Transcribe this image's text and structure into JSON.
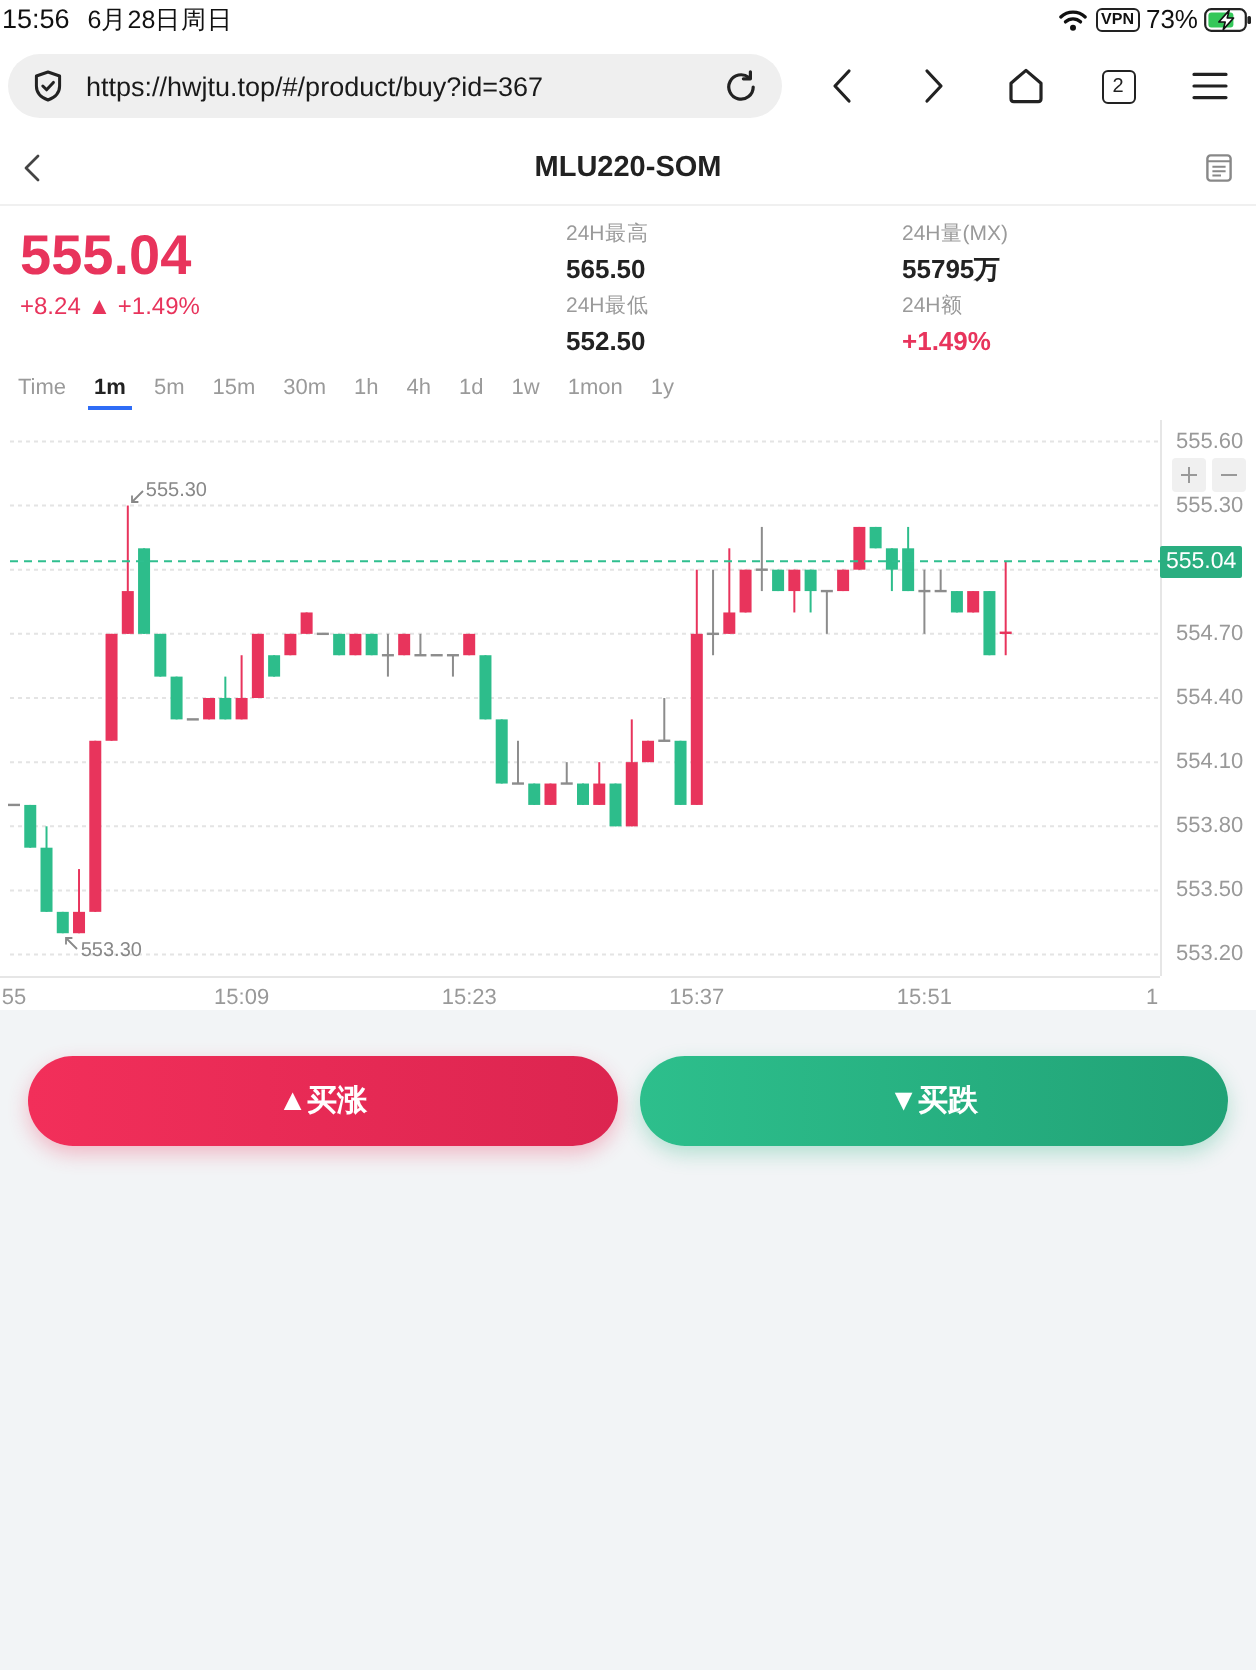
{
  "status_bar": {
    "time": "15:56",
    "date": "6月28日周日",
    "vpn": "VPN",
    "battery": "73%",
    "charging": true
  },
  "browser": {
    "url": "https://hwjtu.top/#/product/buy?id=367",
    "tab_count": "2"
  },
  "header": {
    "title": "MLU220-SOM"
  },
  "quote": {
    "price": "555.04",
    "change": "+8.24 ▲ +1.49%",
    "kind": "up",
    "stats": [
      {
        "label": "24H最高",
        "value": "565.50",
        "kind": "plain"
      },
      {
        "label": "24H量(MX)",
        "value": "55795万",
        "kind": "plain"
      },
      {
        "label": "24H最低",
        "value": "552.50",
        "kind": "plain"
      },
      {
        "label": "24H额",
        "value": "+1.49%",
        "kind": "up"
      }
    ]
  },
  "intervals": [
    {
      "label": "Time",
      "selected": false
    },
    {
      "label": "1m",
      "selected": true
    },
    {
      "label": "5m",
      "selected": false
    },
    {
      "label": "15m",
      "selected": false
    },
    {
      "label": "30m",
      "selected": false
    },
    {
      "label": "1h",
      "selected": false
    },
    {
      "label": "4h",
      "selected": false
    },
    {
      "label": "1d",
      "selected": false
    },
    {
      "label": "1w",
      "selected": false
    },
    {
      "label": "1mon",
      "selected": false
    },
    {
      "label": "1y",
      "selected": false
    }
  ],
  "chart": {
    "chart_data": {
      "type": "candlestick",
      "categories": [
        "55",
        null,
        null,
        null,
        null,
        null,
        null,
        null,
        null,
        null,
        null,
        null,
        null,
        null,
        "15:09",
        null,
        null,
        null,
        null,
        null,
        null,
        null,
        null,
        null,
        null,
        null,
        null,
        null,
        "15:23",
        null,
        null,
        null,
        null,
        null,
        null,
        null,
        null,
        null,
        null,
        null,
        null,
        null,
        "15:37",
        null,
        null,
        null,
        null,
        null,
        null,
        null,
        null,
        null,
        null,
        null,
        null,
        null,
        "15:51",
        null,
        null,
        null,
        null,
        null,
        null,
        null,
        null,
        null,
        null,
        null,
        null,
        null,
        "1"
      ],
      "ohlc": [
        [
          553.9,
          553.9,
          553.9,
          553.9
        ],
        [
          553.9,
          553.9,
          553.7,
          553.7
        ],
        [
          553.7,
          553.8,
          553.4,
          553.4
        ],
        [
          553.4,
          553.4,
          553.3,
          553.3
        ],
        [
          553.3,
          553.6,
          553.3,
          553.4
        ],
        [
          553.4,
          554.2,
          553.4,
          554.2
        ],
        [
          554.2,
          554.7,
          554.2,
          554.7
        ],
        [
          554.7,
          555.3,
          554.7,
          554.9
        ],
        [
          555.1,
          555.1,
          554.7,
          554.7
        ],
        [
          554.7,
          554.7,
          554.5,
          554.5
        ],
        [
          554.5,
          554.5,
          554.3,
          554.3
        ],
        [
          554.3,
          554.3,
          554.3,
          554.3
        ],
        [
          554.3,
          554.4,
          554.3,
          554.4
        ],
        [
          554.4,
          554.5,
          554.3,
          554.3
        ],
        [
          554.3,
          554.6,
          554.3,
          554.4
        ],
        [
          554.4,
          554.7,
          554.4,
          554.7
        ],
        [
          554.6,
          554.6,
          554.5,
          554.5
        ],
        [
          554.6,
          554.7,
          554.6,
          554.7
        ],
        [
          554.7,
          554.8,
          554.7,
          554.8
        ],
        [
          554.7,
          554.7,
          554.7,
          554.7
        ],
        [
          554.7,
          554.7,
          554.6,
          554.6
        ],
        [
          554.6,
          554.7,
          554.6,
          554.7
        ],
        [
          554.7,
          554.7,
          554.6,
          554.6
        ],
        [
          554.6,
          554.7,
          554.5,
          554.6
        ],
        [
          554.6,
          554.7,
          554.6,
          554.7
        ],
        [
          554.6,
          554.7,
          554.6,
          554.6
        ],
        [
          554.6,
          554.6,
          554.6,
          554.6
        ],
        [
          554.6,
          554.6,
          554.5,
          554.6
        ],
        [
          554.6,
          554.7,
          554.6,
          554.7
        ],
        [
          554.6,
          554.6,
          554.3,
          554.3
        ],
        [
          554.3,
          554.3,
          554.0,
          554.0
        ],
        [
          554.0,
          554.2,
          554.0,
          554.0
        ],
        [
          554.0,
          554.0,
          553.9,
          553.9
        ],
        [
          553.9,
          554.0,
          553.9,
          554.0
        ],
        [
          554.0,
          554.1,
          554.0,
          554.0
        ],
        [
          554.0,
          554.0,
          553.9,
          553.9
        ],
        [
          553.9,
          554.1,
          553.9,
          554.0
        ],
        [
          554.0,
          554.0,
          553.8,
          553.8
        ],
        [
          553.8,
          554.3,
          553.8,
          554.1
        ],
        [
          554.1,
          554.2,
          554.1,
          554.2
        ],
        [
          554.2,
          554.4,
          554.2,
          554.2
        ],
        [
          554.2,
          554.2,
          553.9,
          553.9
        ],
        [
          553.9,
          555.0,
          553.9,
          554.7
        ],
        [
          554.7,
          555.0,
          554.6,
          554.7
        ],
        [
          554.7,
          555.1,
          554.7,
          554.8
        ],
        [
          554.8,
          555.0,
          554.8,
          555.0
        ],
        [
          555.0,
          555.2,
          554.9,
          555.0
        ],
        [
          555.0,
          555.0,
          554.9,
          554.9
        ],
        [
          554.9,
          555.0,
          554.8,
          555.0
        ],
        [
          555.0,
          555.0,
          554.8,
          554.9
        ],
        [
          554.9,
          554.9,
          554.7,
          554.9
        ],
        [
          554.9,
          555.0,
          554.9,
          555.0
        ],
        [
          555.0,
          555.2,
          555.0,
          555.2
        ],
        [
          555.2,
          555.2,
          555.1,
          555.1
        ],
        [
          555.1,
          555.1,
          554.9,
          555.0
        ],
        [
          555.1,
          555.2,
          554.9,
          554.9
        ],
        [
          554.9,
          555.0,
          554.7,
          554.9
        ],
        [
          554.9,
          555.0,
          554.9,
          554.9
        ],
        [
          554.9,
          554.9,
          554.8,
          554.8
        ],
        [
          554.8,
          554.9,
          554.8,
          554.9
        ],
        [
          554.9,
          554.9,
          554.6,
          554.6
        ],
        [
          554.7,
          555.04,
          554.6,
          554.71
        ],
        null,
        null,
        null,
        null,
        null,
        null,
        null,
        null,
        null
      ],
      "ylim": [
        553.1,
        555.7
      ],
      "yticks": [
        {
          "value": 553.2,
          "label": "553.20"
        },
        {
          "value": 553.5,
          "label": "553.50"
        },
        {
          "value": 553.8,
          "label": "553.80"
        },
        {
          "value": 554.1,
          "label": "554.10"
        },
        {
          "value": 554.4,
          "label": "554.40"
        },
        {
          "value": 554.7,
          "label": "554.70"
        },
        {
          "value": 555.3,
          "label": "555.30"
        },
        {
          "value": 555.6,
          "label": "555.60"
        }
      ],
      "grid": true,
      "annotations": [
        "555.30",
        "553.30"
      ],
      "ref_lines": [
        {
          "axis": "y",
          "value": 555.04,
          "label": "555.04"
        }
      ]
    }
  },
  "trade_buttons": [
    {
      "label": "▲买涨",
      "kind": "buy_up"
    },
    {
      "label": "▼买跌",
      "kind": "buy_down"
    }
  ]
}
